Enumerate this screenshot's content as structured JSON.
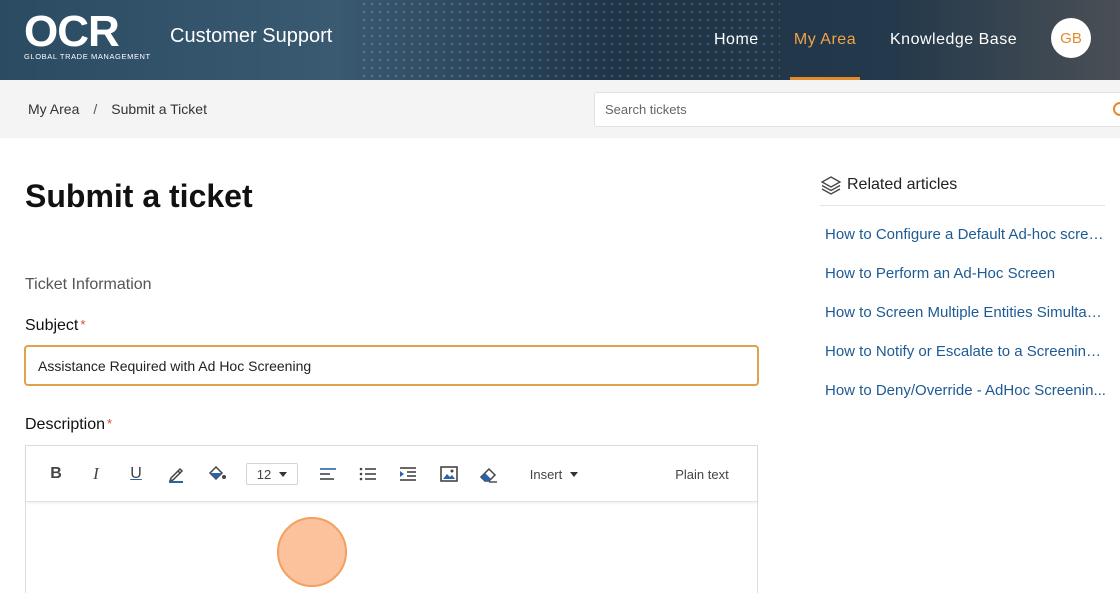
{
  "header": {
    "logo_text": "OCR",
    "logo_subtitle": "GLOBAL TRADE MANAGEMENT",
    "site_title": "Customer Support",
    "nav": [
      {
        "label": "Home",
        "active": false
      },
      {
        "label": "My Area",
        "active": true
      },
      {
        "label": "Knowledge Base",
        "active": false
      }
    ],
    "avatar_initials": "GB",
    "accent_color": "#e38a2a"
  },
  "breadcrumb": {
    "items": [
      "My Area",
      "Submit a Ticket"
    ],
    "separator": "/"
  },
  "search": {
    "placeholder": "Search tickets",
    "icon": "search-icon"
  },
  "main": {
    "title": "Submit a ticket",
    "section": "Ticket Information",
    "subject": {
      "label": "Subject",
      "required_mark": "*",
      "value": "Assistance Required with Ad Hoc Screening"
    },
    "description": {
      "label": "Description",
      "required_mark": "*"
    }
  },
  "editor_toolbar": {
    "bold": "B",
    "italic": "I",
    "underline": "U",
    "font_size": "12",
    "insert_label": "Insert",
    "plain_text_label": "Plain text",
    "icons": [
      "pen-color-icon",
      "fill-color-icon",
      "align-left-icon",
      "bullet-list-icon",
      "indent-icon",
      "image-icon",
      "eraser-icon"
    ]
  },
  "sidebar": {
    "title": "Related articles",
    "articles": [
      "How to Configure a Default Ad-hoc scree...",
      "How to Perform an Ad-Hoc Screen",
      "How to Screen Multiple Entities Simultan...",
      "How to Notify or Escalate to a Screening ...",
      "How to Deny/Override - AdHoc Screenin..."
    ]
  }
}
